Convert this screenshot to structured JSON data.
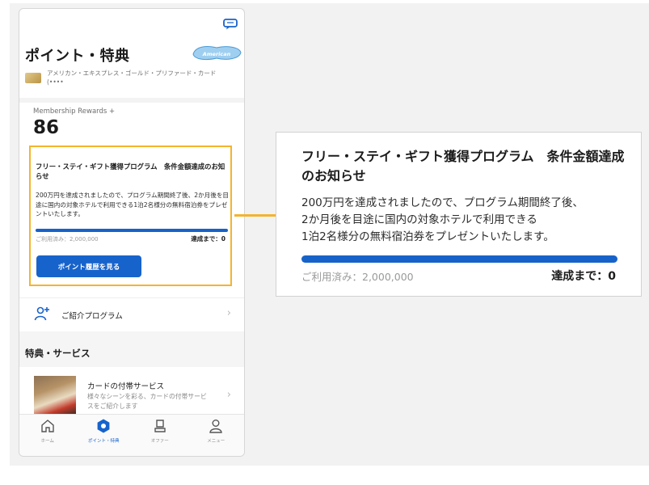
{
  "header": {
    "title": "ポイント・特典",
    "card_name": "アメリカン・エキスプレス・ゴールド・プリファード・カード (••••",
    "logo_text": "AMERICAN EXPRESS"
  },
  "points": {
    "label": "Membership Rewards +",
    "value": "86"
  },
  "notice": {
    "title": "フリー・ステイ・ギフト獲得プログラム　条件金額達成のお知らせ",
    "body": "200万円を達成されましたので、プログラム期間終了後、2か月後を目途に国内の対象ホテルで利用できる1泊2名様分の無料宿泊券をプレゼントいたします。",
    "used": "ご利用済み：2,000,000",
    "remaining": "達成まで：0",
    "progress": 1.0,
    "button_label": "ポイント履歴を見る"
  },
  "zoom": {
    "title": "フリー・ステイ・ギフト獲得プログラム　条件金額達成のお知らせ",
    "body_lines": [
      "200万円を達成されましたので、プログラム期間終了後、",
      "2か月後を目途に国内の対象ホテルで利用できる",
      "1泊2名様分の無料宿泊券をプレゼントいたします。"
    ],
    "used": "ご利用済み：2,000,000",
    "remaining": "達成まで：0"
  },
  "referral": {
    "label": "ご紹介プログラム",
    "icon": "add-person-icon"
  },
  "section": {
    "title": "特典・サービス"
  },
  "service": {
    "title": "カードの付帯サービス",
    "desc": "様々なシーンを彩る、カードの付帯サービスをご紹介します"
  },
  "tabs": [
    {
      "label": "ホーム",
      "icon": "home-icon"
    },
    {
      "label": "ポイント・特典",
      "icon": "points-icon"
    },
    {
      "label": "オファー",
      "icon": "offer-icon"
    },
    {
      "label": "メニュー",
      "icon": "menu-icon"
    }
  ],
  "colors": {
    "accent": "#1763cc",
    "highlight": "#f4b42e",
    "progress": "#1762c9"
  }
}
